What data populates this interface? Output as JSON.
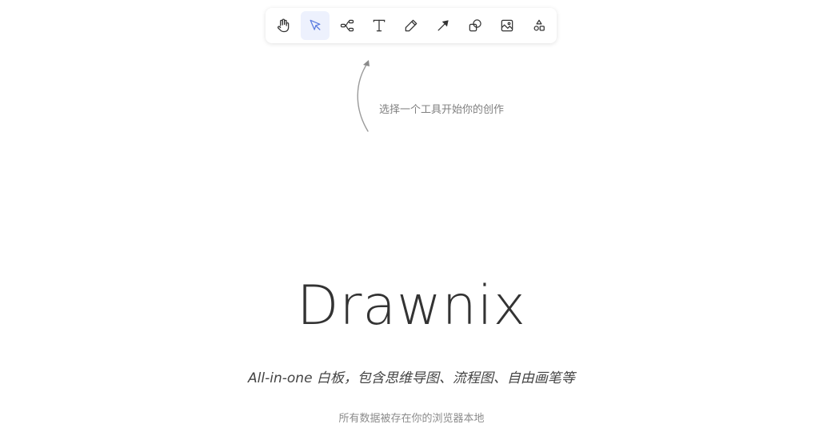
{
  "toolbar": {
    "tools": [
      {
        "name": "hand",
        "icon": "hand-icon",
        "active": false
      },
      {
        "name": "selection",
        "icon": "pointer-icon",
        "active": true
      },
      {
        "name": "mind-map",
        "icon": "mind-map-icon",
        "active": false
      },
      {
        "name": "text",
        "icon": "text-icon",
        "active": false
      },
      {
        "name": "pen",
        "icon": "pen-icon",
        "active": false
      },
      {
        "name": "arrow",
        "icon": "arrow-icon",
        "active": false
      },
      {
        "name": "shape",
        "icon": "shape-icon",
        "active": false
      },
      {
        "name": "image",
        "icon": "image-icon",
        "active": false
      },
      {
        "name": "extra-tools",
        "icon": "shapes-more-icon",
        "active": false
      }
    ],
    "active_color": "#edf1fd",
    "active_icon_color": "#5b7ce0"
  },
  "hint": {
    "text": "选择一个工具开始你的创作"
  },
  "welcome": {
    "title": "Drawnix",
    "subtitle": "All-in-one 白板，包含思维导图、流程图、自由画笔等",
    "storage_note": "所有数据被存在你的浏览器本地"
  }
}
